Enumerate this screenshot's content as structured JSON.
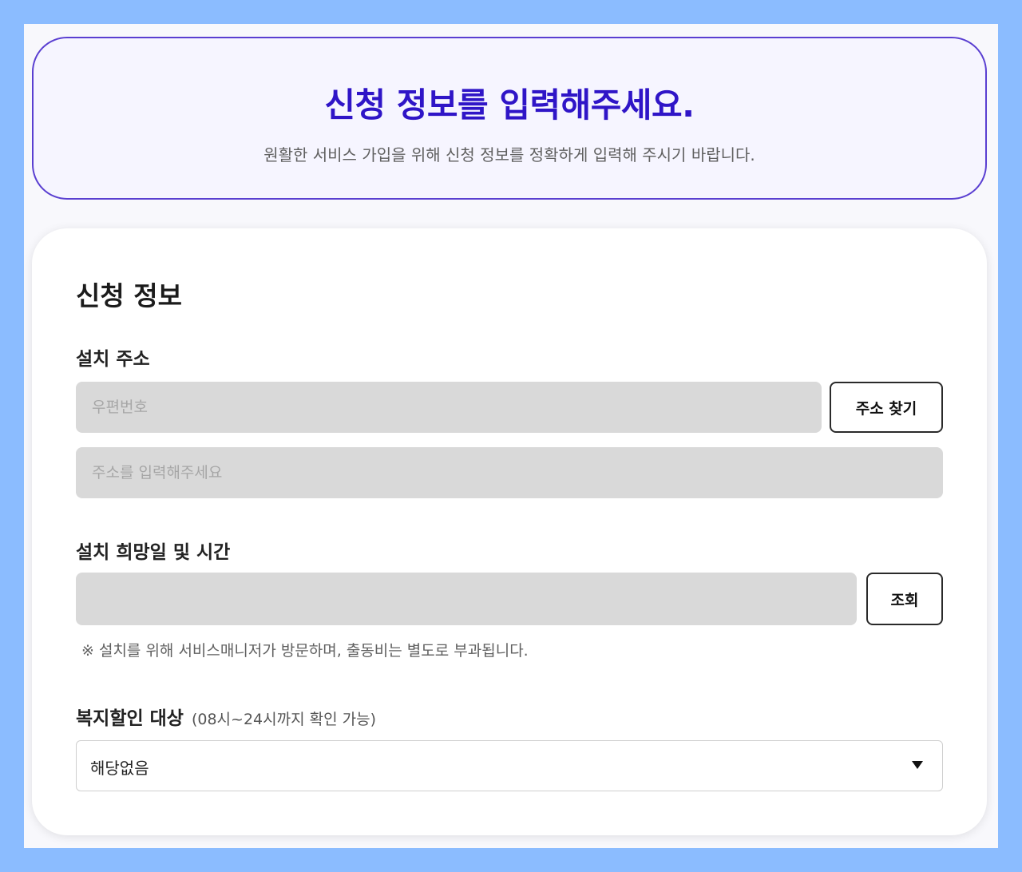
{
  "banner": {
    "title": "신청 정보를 입력해주세요.",
    "description": "원활한 서비스 가입을 위해 신청 정보를 정확하게 입력해 주시기 바랍니다."
  },
  "form": {
    "section_title": "신청 정보",
    "address": {
      "label": "설치 주소",
      "postcode_placeholder": "우편번호",
      "postcode_value": "",
      "search_button": "주소 찾기",
      "address_placeholder": "주소를 입력해주세요",
      "address_value": ""
    },
    "schedule": {
      "label": "설치 희망일 및 시간",
      "value": "",
      "lookup_button": "조회",
      "notice": "※ 설치를 위해 서비스매니저가 방문하며, 출동비는 별도로 부과됩니다."
    },
    "welfare": {
      "label": "복지할인 대상",
      "note": "(08시~24시까지 확인 가능)",
      "selected": "해당없음",
      "caret_icon": "caret-down-icon"
    }
  },
  "colors": {
    "outer_background": "#8bbcff",
    "banner_border": "#5a3fd1",
    "banner_title": "#2f15c7",
    "input_fill": "#d9d9d9"
  }
}
